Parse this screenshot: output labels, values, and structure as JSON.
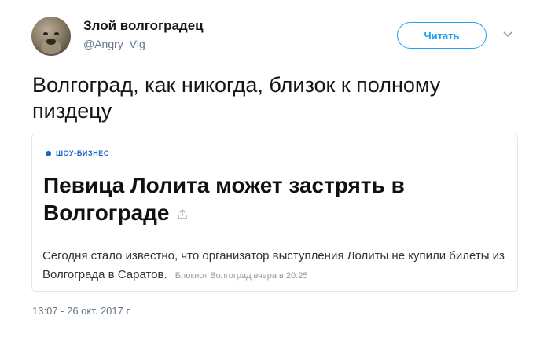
{
  "author": {
    "name": "Злой волгоградец",
    "handle": "@Angry_Vlg"
  },
  "follow_button": "Читать",
  "tweet_text": "Волгоград, как никогда, близок к полному пиздецу",
  "card": {
    "category": "ШОУ-БИЗНЕС",
    "headline": "Певица Лолита может застрять в Волгограде",
    "description": "Сегодня стало известно, что организатор выступления Лолиты не купили билеты из Волгограда в Саратов.",
    "source": "Блокнот Волгоград вчера в 20:25"
  },
  "timestamp": "13:07 - 26 окт. 2017 г.",
  "colors": {
    "accent": "#1da1f2",
    "category": "#1e64c8",
    "muted": "#657786"
  }
}
